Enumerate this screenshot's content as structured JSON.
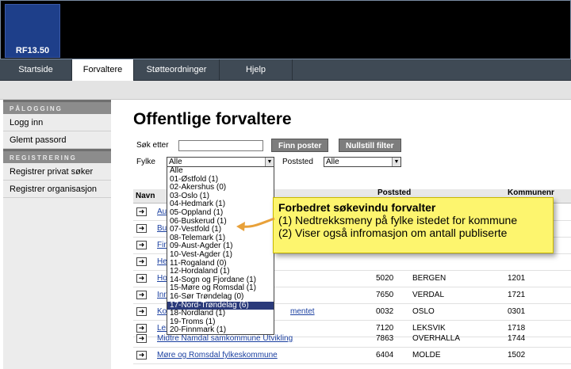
{
  "app": {
    "logo": "RF13.50"
  },
  "nav": {
    "tabs": [
      {
        "label": "Startside"
      },
      {
        "label": "Forvaltere"
      },
      {
        "label": "Støtteordninger"
      },
      {
        "label": "Hjelp"
      }
    ],
    "active_tab": "Forvaltere"
  },
  "sidebar": {
    "login_heading": "PÅLOGGING",
    "login_items": [
      "Logg inn",
      "Glemt passord"
    ],
    "register_heading": "REGISTRERING",
    "register_items": [
      "Registrer privat søker",
      "Registrer organisasjon"
    ]
  },
  "main": {
    "title": "Offentlige forvaltere",
    "search_label": "Søk etter",
    "search_value": "",
    "find_button": "Finn poster",
    "reset_button": "Nullstill filter",
    "county_label": "Fylke",
    "county_value": "Alle",
    "postal_label": "Poststed",
    "postal_value": "Alle",
    "table": {
      "headers": {
        "name": "Navn",
        "postal": "Poststed",
        "municipality": "Kommunenr"
      },
      "rows": [
        {
          "name": "Au",
          "postcode": "",
          "place": "",
          "municipality": ""
        },
        {
          "name": "Bu",
          "postcode": "",
          "place": "",
          "municipality": ""
        },
        {
          "name": "Fin",
          "postcode": "",
          "place": "",
          "municipality": ""
        },
        {
          "name": "He",
          "postcode": "",
          "place": "",
          "municipality": ""
        },
        {
          "name": "Ho",
          "postcode": "5020",
          "place": "BERGEN",
          "municipality": "1201"
        },
        {
          "name": "Inn",
          "postcode": "7650",
          "place": "VERDAL",
          "municipality": "1721"
        },
        {
          "name": "Ko",
          "name_tail": "mentet",
          "postcode": "0032",
          "place": "OSLO",
          "municipality": "0301"
        },
        {
          "name": "Lei",
          "postcode": "7120",
          "place": "LEKSVIK",
          "municipality": "1718"
        },
        {
          "name": "Midtre Namdal samkommune Utvikling",
          "postcode": "7863",
          "place": "OVERHALLA",
          "municipality": "1744"
        },
        {
          "name": "Møre og Romsdal fylkeskommune",
          "postcode": "6404",
          "place": "MOLDE",
          "municipality": "1502"
        }
      ]
    }
  },
  "dropdown": {
    "options": [
      "Alle",
      "01-Østfold (1)",
      "02-Akershus (0)",
      "03-Oslo (1)",
      "04-Hedmark (1)",
      "05-Oppland (1)",
      "06-Buskerud (1)",
      "07-Vestfold (1)",
      "08-Telemark (1)",
      "09-Aust-Agder (1)",
      "10-Vest-Agder (1)",
      "11-Rogaland (0)",
      "12-Hordaland (1)",
      "14-Sogn og Fjordane (1)",
      "15-Møre og Romsdal (1)",
      "16-Sør Trøndelag (0)",
      "17-Nord-Trøndelag (6)",
      "18-Nordland (1)",
      "19-Troms (1)",
      "20-Finnmark (1)"
    ],
    "selected": "17-Nord-Trøndelag (6)"
  },
  "callout": {
    "title": "Forbedret søkevindu forvalter",
    "line1": "(1) Nedtrekksmeny på fylke istedet for kommune",
    "line2": "(2) Viser også infromasjon om antall publiserte"
  },
  "colors": {
    "header": "#000000",
    "logo": "#1e3f8a",
    "nav": "#3f4a55",
    "link": "#1a3fa0",
    "callout": "#fdf56e",
    "selected_option": "#2a3a7a",
    "arrow": "#e8a13a"
  },
  "icons": {
    "row_icon": "arrow-right-icon",
    "select_arrow": "chevron-down-icon"
  }
}
